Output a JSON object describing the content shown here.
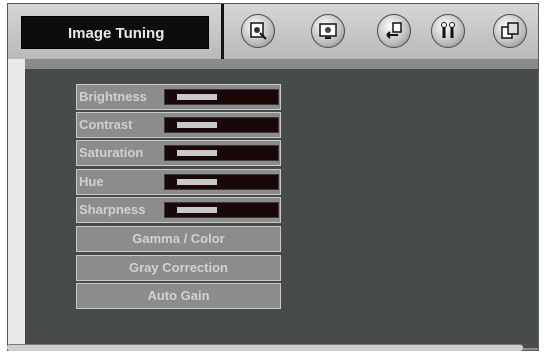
{
  "header": {
    "title": "Image Tuning",
    "icons": [
      "picture-adjust-icon",
      "display-screen-icon",
      "input-source-icon",
      "tools-icon",
      "copy-windows-icon"
    ]
  },
  "menu": {
    "sliders": [
      {
        "label": "Brightness",
        "level": 0.35
      },
      {
        "label": "Contrast",
        "level": 0.35
      },
      {
        "label": "Saturation",
        "level": 0.35
      },
      {
        "label": "Hue",
        "level": 0.35
      },
      {
        "label": "Sharpness",
        "level": 0.35
      }
    ],
    "buttons": [
      {
        "label": "Gamma / Color"
      },
      {
        "label": "Gray Correction"
      },
      {
        "label": "Auto Gain"
      }
    ]
  }
}
